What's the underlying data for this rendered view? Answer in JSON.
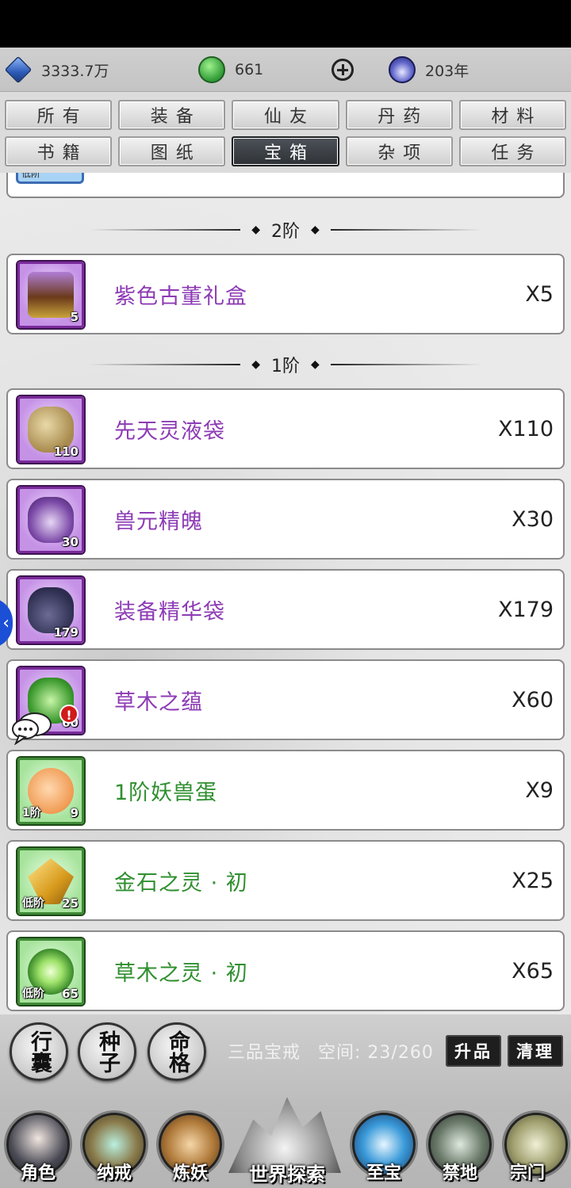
{
  "resources": {
    "spirit_stones": "3333.7万",
    "spirit_energy": "661",
    "lifespan": "203年"
  },
  "tabs": {
    "row1": [
      "所有",
      "装备",
      "仙友",
      "丹药",
      "材料"
    ],
    "row2": [
      "书籍",
      "图纸",
      "宝箱",
      "杂项",
      "任务"
    ],
    "active": "宝箱"
  },
  "list": {
    "partial_top_tier": "低阶",
    "sections": [
      {
        "tier_label": "2阶",
        "items": [
          {
            "name": "紫色古董礼盒",
            "quantity": "X5",
            "count_badge": "5",
            "rarity": "purple"
          }
        ]
      },
      {
        "tier_label": "1阶",
        "items": [
          {
            "name": "先天灵液袋",
            "quantity": "X110",
            "count_badge": "110",
            "rarity": "purple"
          },
          {
            "name": "兽元精魄",
            "quantity": "X30",
            "count_badge": "30",
            "rarity": "purple"
          },
          {
            "name": "装备精华袋",
            "quantity": "X179",
            "count_badge": "179",
            "rarity": "purple"
          },
          {
            "name": "草木之蕴",
            "quantity": "X60",
            "count_badge": "60",
            "rarity": "purple",
            "alert": "!"
          },
          {
            "name": "1阶妖兽蛋",
            "quantity": "X9",
            "count_badge": "9",
            "tier_badge": "1阶",
            "rarity": "green"
          },
          {
            "name": "金石之灵 · 初",
            "quantity": "X25",
            "count_badge": "25",
            "tier_badge": "低阶",
            "rarity": "green"
          },
          {
            "name": "草木之灵 · 初",
            "quantity": "X65",
            "count_badge": "65",
            "tier_badge": "低阶",
            "rarity": "green"
          }
        ]
      }
    ]
  },
  "bag_controls": {
    "buttons": [
      "行囊",
      "种子",
      "命格"
    ],
    "ring_name": "三品宝戒",
    "space": "空间: 23/260",
    "upgrade": "升品",
    "cleanup": "清理"
  },
  "bottom_nav": [
    "角色",
    "纳戒",
    "炼妖",
    "世界探索",
    "至宝",
    "禁地",
    "宗门"
  ],
  "colors": {
    "purple_text": "#8d3bb5",
    "green_text": "#2f8f2f",
    "active_tab": "#2e3237"
  }
}
